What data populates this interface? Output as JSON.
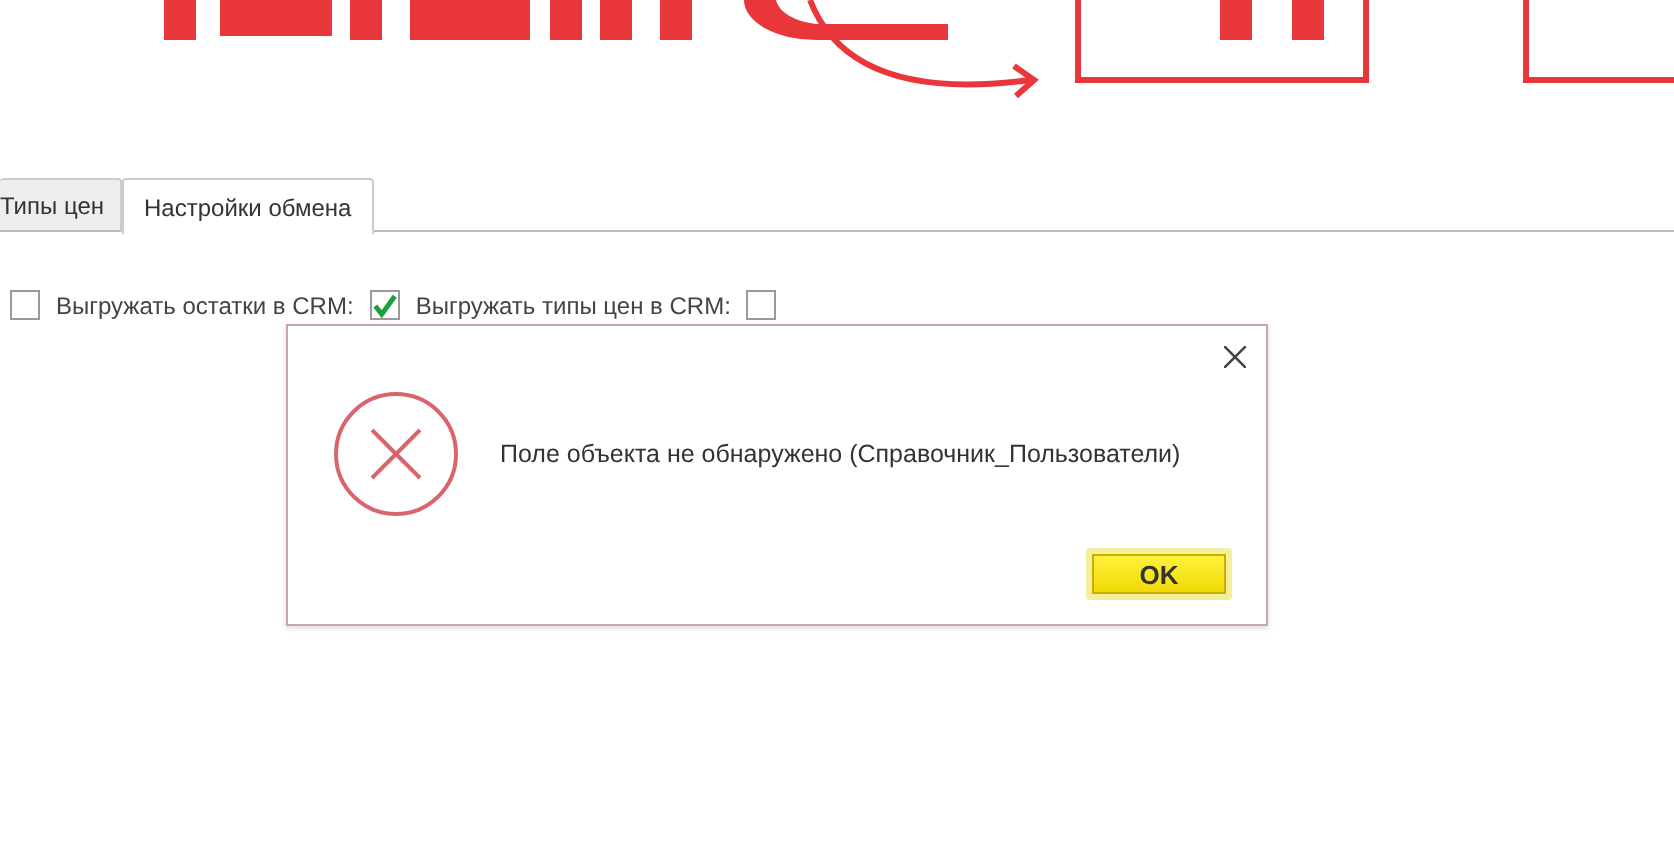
{
  "tabs": [
    {
      "label": "Типы цен",
      "selected": false
    },
    {
      "label": "Настройки обмена",
      "selected": true
    }
  ],
  "leading_checkbox": {
    "checked": false
  },
  "options": [
    {
      "label": "Выгружать остатки в CRM:",
      "checked": true
    },
    {
      "label": "Выгружать типы цен в CRM:",
      "checked": false
    }
  ],
  "dialog": {
    "message": "Поле объекта не обнаружено (Справочник_Пользователи)",
    "button": "OK"
  }
}
